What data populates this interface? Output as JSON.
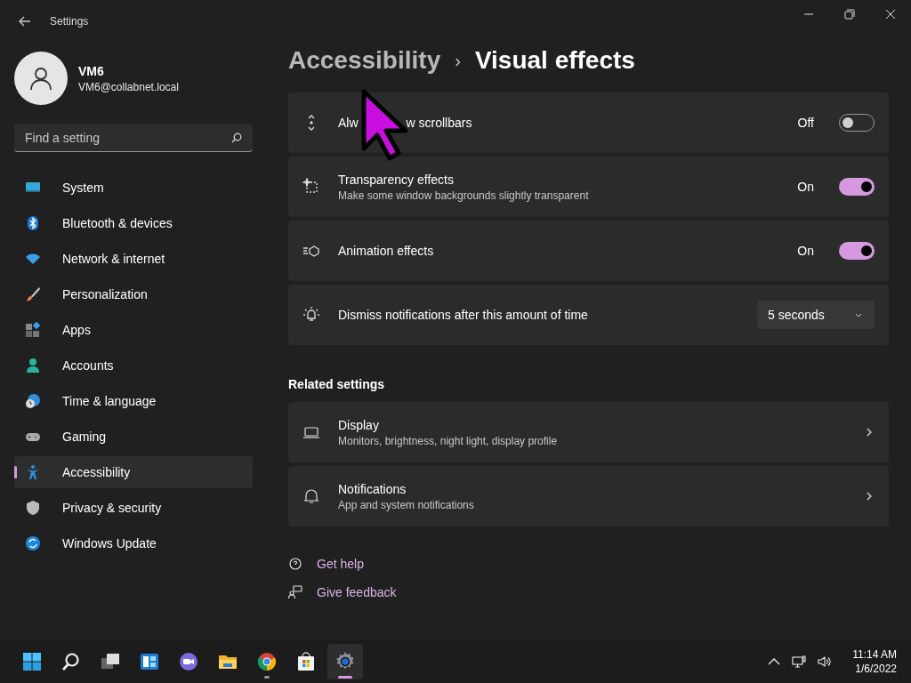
{
  "window": {
    "title": "Settings"
  },
  "user": {
    "name": "VM6",
    "email": "VM6@collabnet.local"
  },
  "search": {
    "placeholder": "Find a setting"
  },
  "sidebar": {
    "items": [
      {
        "label": "System",
        "selected": false
      },
      {
        "label": "Bluetooth & devices",
        "selected": false
      },
      {
        "label": "Network & internet",
        "selected": false
      },
      {
        "label": "Personalization",
        "selected": false
      },
      {
        "label": "Apps",
        "selected": false
      },
      {
        "label": "Accounts",
        "selected": false
      },
      {
        "label": "Time & language",
        "selected": false
      },
      {
        "label": "Gaming",
        "selected": false
      },
      {
        "label": "Accessibility",
        "selected": true
      },
      {
        "label": "Privacy & security",
        "selected": false
      },
      {
        "label": "Windows Update",
        "selected": false
      }
    ]
  },
  "breadcrumb": {
    "parent": "Accessibility",
    "separator": "›",
    "current": "Visual effects"
  },
  "settings": [
    {
      "kind": "toggle",
      "title": "Alw",
      "title_after_cursor": "w scrollbars",
      "on": false,
      "state": "Off"
    },
    {
      "kind": "toggle",
      "title": "Transparency effects",
      "description": "Make some window backgrounds slightly transparent",
      "on": true,
      "state": "On"
    },
    {
      "kind": "toggle",
      "title": "Animation effects",
      "on": true,
      "state": "On"
    },
    {
      "kind": "dropdown",
      "title": "Dismiss notifications after this amount of time",
      "value": "5 seconds"
    }
  ],
  "related": {
    "heading": "Related settings",
    "items": [
      {
        "title": "Display",
        "description": "Monitors, brightness, night light, display profile"
      },
      {
        "title": "Notifications",
        "description": "App and system notifications"
      }
    ]
  },
  "help_links": [
    "Get help",
    "Give feedback"
  ],
  "taskbar": {
    "apps": [
      {
        "running": false,
        "selected": false
      },
      {
        "running": false,
        "selected": false
      },
      {
        "running": false,
        "selected": false
      },
      {
        "running": false,
        "selected": false
      },
      {
        "running": false,
        "selected": false
      },
      {
        "running": false,
        "selected": false
      },
      {
        "running": true,
        "selected": false
      },
      {
        "running": false,
        "selected": false
      },
      {
        "running": true,
        "selected": true
      }
    ],
    "time": "11:14 AM",
    "date": "1/6/2022"
  }
}
